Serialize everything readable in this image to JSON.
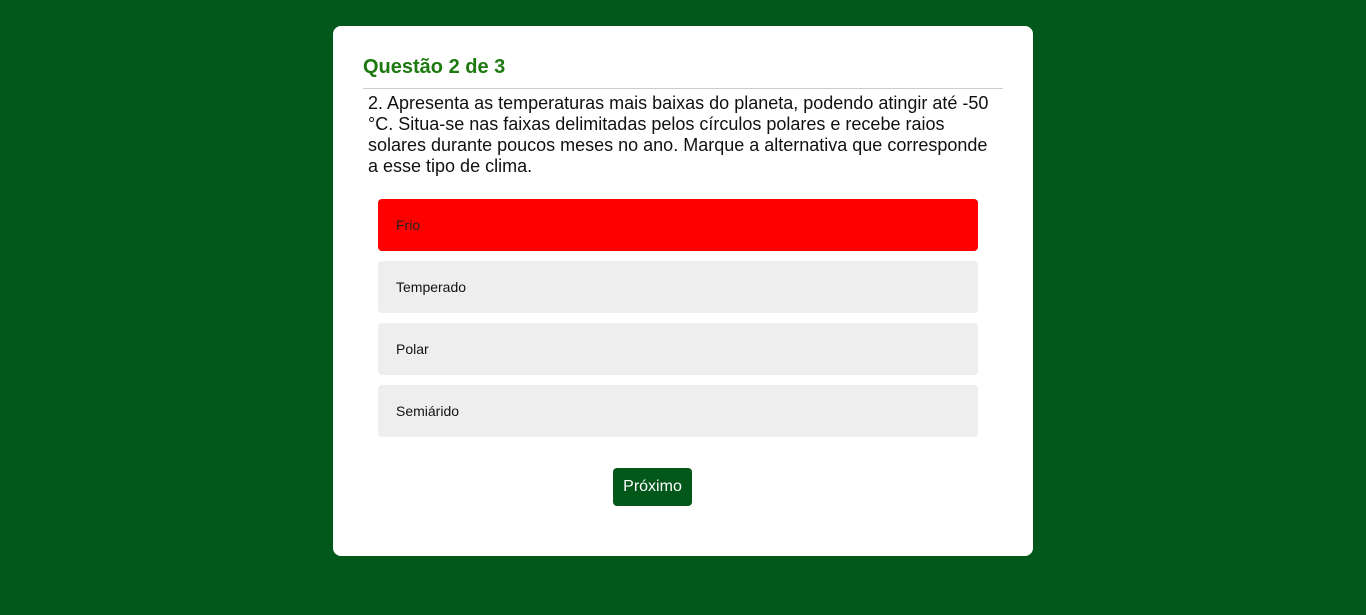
{
  "quiz": {
    "title": "Questão 2 de 3",
    "question": "2. Apresenta as temperaturas mais baixas do planeta, podendo atingir até -50 °C. Situa-se nas faixas delimitadas pelos círculos polares e recebe raios solares durante poucos meses no ano. Marque a alternativa que corresponde a esse tipo de clima.",
    "options": [
      {
        "label": "Frio",
        "state": "incorrect"
      },
      {
        "label": "Temperado",
        "state": "default"
      },
      {
        "label": "Polar",
        "state": "default"
      },
      {
        "label": "Semiárido",
        "state": "default"
      }
    ],
    "next_label": "Próximo"
  },
  "colors": {
    "background": "#02571a",
    "title": "#1e7a10",
    "incorrect": "#ff0000",
    "option_default": "#eeeeee",
    "button": "#02571a"
  }
}
